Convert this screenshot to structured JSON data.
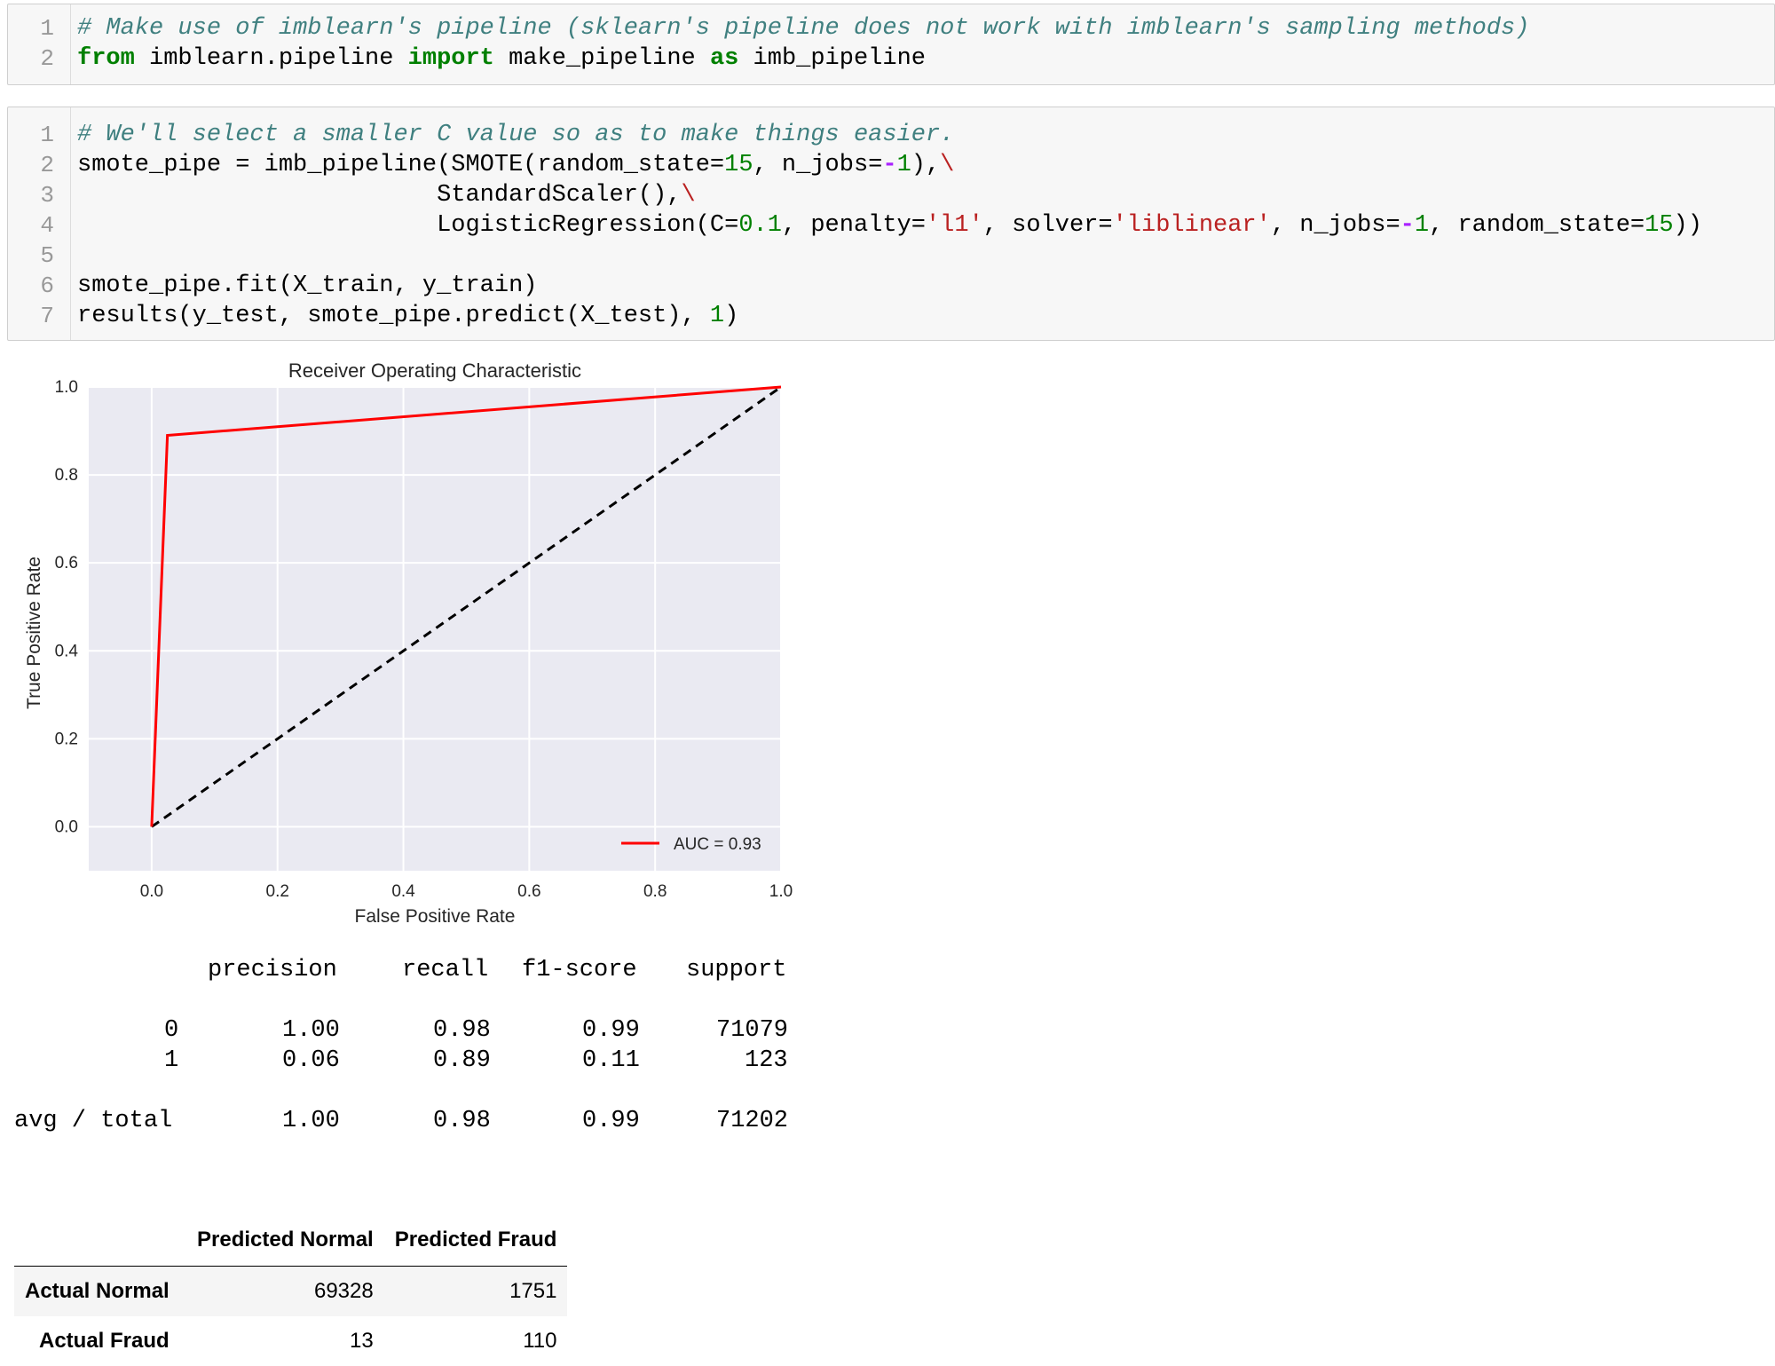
{
  "cell1": {
    "lines": [
      {
        "no": "1",
        "tokens": [
          [
            "cm",
            "# Make use of imblearn's pipeline (sklearn's pipeline does not work with imblearn's sampling methods)"
          ]
        ]
      },
      {
        "no": "2",
        "tokens": [
          [
            "kw",
            "from"
          ],
          [
            "",
            " imblearn.pipeline "
          ],
          [
            "kw",
            "import"
          ],
          [
            "",
            " make_pipeline "
          ],
          [
            "kw",
            "as"
          ],
          [
            "",
            " imb_pipeline"
          ]
        ]
      }
    ]
  },
  "cell2": {
    "lines": [
      {
        "no": "1",
        "tokens": [
          [
            "cm",
            "# We'll select a smaller C value so as to make things easier."
          ]
        ]
      },
      {
        "no": "2",
        "tokens": [
          [
            "",
            "smote_pipe = imb_pipeline(SMOTE(random_state="
          ],
          [
            "num",
            "15"
          ],
          [
            "",
            ", n_jobs="
          ],
          [
            "op",
            "-"
          ],
          [
            "num",
            "1"
          ],
          [
            "",
            "),"
          ],
          [
            "str",
            "\\"
          ]
        ]
      },
      {
        "no": "3",
        "tokens": [
          [
            "",
            "                         StandardScaler(),"
          ],
          [
            "str",
            "\\"
          ]
        ]
      },
      {
        "no": "4",
        "tokens": [
          [
            "",
            "                         LogisticRegression(C="
          ],
          [
            "num",
            "0.1"
          ],
          [
            "",
            ", penalty="
          ],
          [
            "str",
            "'l1'"
          ],
          [
            "",
            ", solver="
          ],
          [
            "str",
            "'liblinear'"
          ],
          [
            "",
            ", n_jobs="
          ],
          [
            "op",
            "-"
          ],
          [
            "num",
            "1"
          ],
          [
            "",
            ", random_state="
          ],
          [
            "num",
            "15"
          ],
          [
            "",
            "))"
          ]
        ]
      },
      {
        "no": "5",
        "tokens": []
      },
      {
        "no": "6",
        "tokens": [
          [
            "",
            "smote_pipe.fit(X_train, y_train)"
          ]
        ]
      },
      {
        "no": "7",
        "tokens": [
          [
            "",
            "results(y_test, smote_pipe.predict(X_test), "
          ],
          [
            "num",
            "1"
          ],
          [
            "",
            ")"
          ]
        ]
      }
    ]
  },
  "chart_data": {
    "type": "line",
    "title": "Receiver Operating Characteristic",
    "xlabel": "False Positive Rate",
    "ylabel": "True Positive Rate",
    "xlim": [
      -0.1,
      1.0
    ],
    "ylim": [
      -0.1,
      1.0
    ],
    "x_ticks": [
      "0.0",
      "0.2",
      "0.4",
      "0.6",
      "0.8",
      "1.0"
    ],
    "y_ticks": [
      "0.0",
      "0.2",
      "0.4",
      "0.6",
      "0.8",
      "1.0"
    ],
    "grid": true,
    "legend_position": "lower-right",
    "series": [
      {
        "name": "AUC = 0.93",
        "color": "#ff0000",
        "style": "solid",
        "x": [
          0.0,
          0.025,
          1.0
        ],
        "y": [
          0.0,
          0.89,
          1.0
        ]
      },
      {
        "color": "#000000",
        "style": "dashed",
        "x": [
          0.0,
          1.0
        ],
        "y": [
          0.0,
          1.0
        ]
      }
    ]
  },
  "report": {
    "headers": [
      "precision",
      "recall",
      "f1-score",
      "support"
    ],
    "rows": [
      {
        "label": "0",
        "values": [
          "1.00",
          "0.98",
          "0.99",
          "71079"
        ]
      },
      {
        "label": "1",
        "values": [
          "0.06",
          "0.89",
          "0.11",
          "123"
        ]
      }
    ],
    "avg": {
      "label": "avg / total",
      "values": [
        "1.00",
        "0.98",
        "0.99",
        "71202"
      ]
    }
  },
  "confusion": {
    "columns": [
      "Predicted Normal",
      "Predicted Fraud"
    ],
    "rows": [
      {
        "label": "Actual Normal",
        "values": [
          "69328",
          "1751"
        ]
      },
      {
        "label": "Actual Fraud",
        "values": [
          "13",
          "110"
        ]
      }
    ]
  }
}
